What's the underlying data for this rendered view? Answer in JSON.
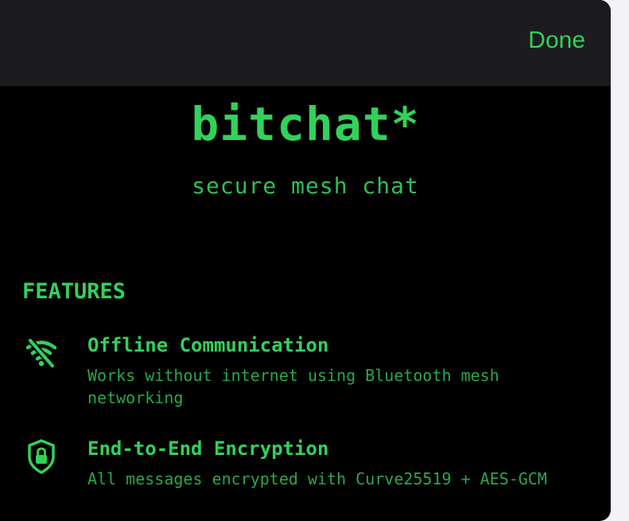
{
  "navbar": {
    "done_label": "Done"
  },
  "header": {
    "title": "bitchat*",
    "subtitle": "secure mesh chat"
  },
  "features": {
    "heading": "FEATURES",
    "items": [
      {
        "icon": "wifi-slash-icon",
        "title": "Offline Communication",
        "description": "Works without internet using Bluetooth mesh networking"
      },
      {
        "icon": "lock-shield-icon",
        "title": "End-to-End Encryption",
        "description": "All messages encrypted with Curve25519 + AES-GCM"
      }
    ]
  },
  "colors": {
    "accent": "#32d15a",
    "background": "#000000",
    "navbar": "#1c1c1e"
  }
}
